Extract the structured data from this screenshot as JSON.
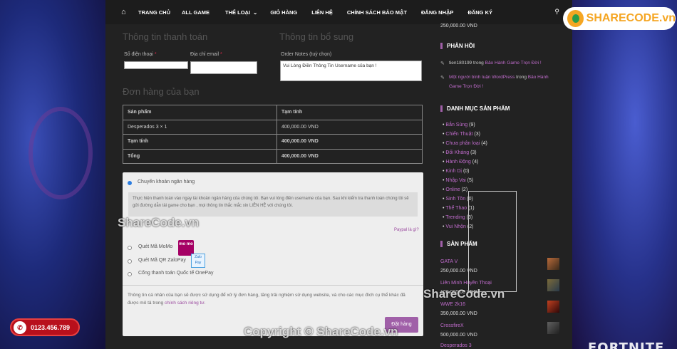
{
  "nav": {
    "items": [
      "TRANG CHỦ",
      "ALL GAME",
      "THỂ LOẠI",
      "GIỎ HÀNG",
      "LIÊN HỆ",
      "CHÍNH SÁCH BẢO MẬT",
      "ĐĂNG NHẬP",
      "ĐĂNG KÝ"
    ],
    "dropdown_icon": "chevron-down-icon",
    "search_icon": "search-icon",
    "home_icon": "home-icon"
  },
  "logo": {
    "text": "SHARECODE.vn"
  },
  "billing": {
    "title": "Thông tin thanh toán",
    "phone_label": "Số điện thoại",
    "email_label": "Địa chỉ email",
    "required_mark": "*"
  },
  "extra": {
    "title": "Thông tin bổ sung",
    "notes_label": "Order Notes (tuỳ chọn)",
    "notes_value": "Vui Lòng Điền Thông Tin Username của bạn !"
  },
  "order": {
    "title": "Đơn hàng của bạn",
    "headers": [
      "Sản phẩm",
      "Tạm tính"
    ],
    "rows": [
      [
        "Desperados 3  × 1",
        "400,000.00 VND"
      ],
      [
        "Tạm tính",
        "400,000.00 VND"
      ],
      [
        "Tổng",
        "400,000.00 VND"
      ]
    ]
  },
  "payment": {
    "methods": [
      "Chuyển khoản ngân hàng",
      "Quét Mã MoMo",
      "Quét Mã QR ZaloPay",
      "Cổng thanh toán Quốc tế OnePay"
    ],
    "bank_note": "Thực hiện thanh toán vào ngay tài khoản ngân hàng của chúng tôi. Bạn vui lòng điền username của bạn. Sau khi kiểm tra thanh toán chúng tôi sẽ gửi đường dẫn tải game cho bạn , mọi thông tin thắc mắc xin LIÊN HỆ với chúng tôi.",
    "paypal_link": "Paypal là gì?",
    "momo_logo": "mo mo",
    "zalo_logo": "Zalo Pay",
    "privacy_text": "Thông tin cá nhân của bạn sẽ được sử dụng để xử lý đơn hàng, tăng trải nghiệm sử dụng website, và cho các mục đích cụ thể khác đã được mô tả trong",
    "privacy_link": "chính sách riêng tư",
    "privacy_end": ".",
    "place_order": "Đặt hàng"
  },
  "sidebar": {
    "top_price": "250,000.00 VND",
    "feedback_title": "PHẢN HỒI",
    "comments": [
      {
        "author": "tien180199",
        "mid": " trong ",
        "post": "Bảo Hành Game Trọn Đời !"
      },
      {
        "author": "Một người bình luận WordPress",
        "mid": " trong ",
        "post": "Bảo Hành Game Trọn Đời !"
      }
    ],
    "categories_title": "DANH MỤC SẢN PHẨM",
    "categories": [
      {
        "name": "Bắn Súng",
        "count": "(9)"
      },
      {
        "name": "Chiến Thuật",
        "count": "(3)"
      },
      {
        "name": "Chưa phân loại",
        "count": "(4)"
      },
      {
        "name": "Đối Kháng",
        "count": "(3)"
      },
      {
        "name": "Hành Động",
        "count": "(4)"
      },
      {
        "name": "Kinh Dị",
        "count": "(0)"
      },
      {
        "name": "Nhập Vai",
        "count": "(5)"
      },
      {
        "name": "Online",
        "count": "(2)"
      },
      {
        "name": "Sinh Tồn",
        "count": "(0)"
      },
      {
        "name": "Thể Thao",
        "count": "(1)"
      },
      {
        "name": "Trending",
        "count": "(3)"
      },
      {
        "name": "Vui Nhộn",
        "count": "(2)"
      }
    ],
    "products_title": "SẢN PHẨM",
    "products": [
      {
        "name": "GATA V",
        "price": "250,000.00 VND"
      },
      {
        "name": "Liên Minh Huyền Thoại",
        "price": "100,000.00 VND"
      },
      {
        "name": "WWE 2k16",
        "price": "350,000.00 VND"
      },
      {
        "name": "CrossfireX",
        "price": "500,000.00 VND"
      },
      {
        "name": "Desperados 3",
        "price": ""
      }
    ]
  },
  "call": {
    "number": "0123.456.789"
  },
  "watermarks": [
    "ShareCode.vn",
    "ShareCode.vn",
    "Copyright © ShareCode.vn"
  ],
  "background_text": "FORTNITE",
  "colors": {
    "accent": "#a060a8",
    "link": "#c06ccc",
    "call": "#b8101c"
  }
}
